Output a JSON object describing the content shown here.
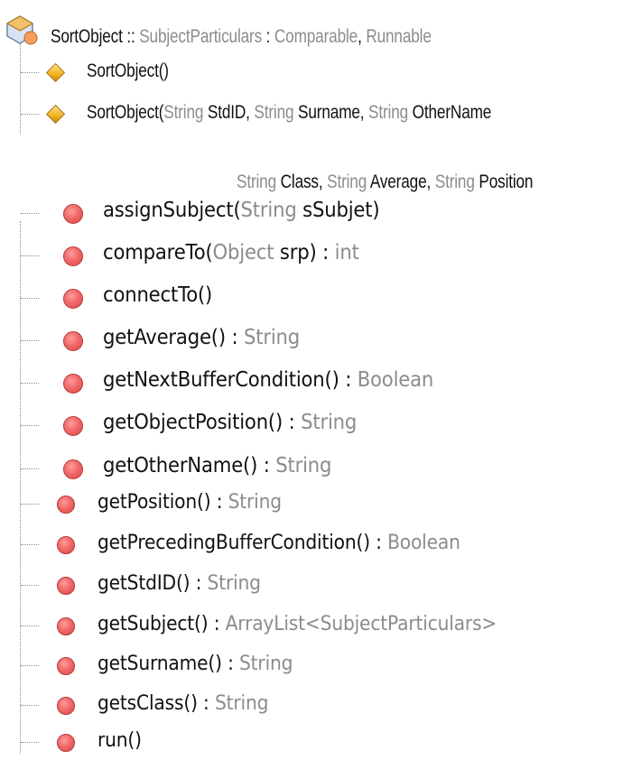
{
  "header": {
    "name": "SortObject",
    "sep": " :: ",
    "extends": "SubjectParticulars",
    "colon": " : ",
    "iface1": "Comparable",
    "comma": ", ",
    "iface2": "Runnable"
  },
  "constructors": [
    {
      "name": "SortObject()"
    },
    {
      "name": "SortObject(",
      "params": [
        {
          "type": "String",
          "name": "StdID"
        },
        {
          "type": "String",
          "name": "Surname"
        },
        {
          "type": "String",
          "name": "OtherName"
        }
      ],
      "continuation": [
        {
          "type": "String",
          "name": "Class"
        },
        {
          "type": "String",
          "name": "Average"
        },
        {
          "type": "String",
          "name": "Position"
        }
      ]
    }
  ],
  "methods": [
    {
      "sig": "assignSubject(",
      "ptype": "String",
      "pname": "sSubjet",
      "close": ")",
      "ret_sep": "",
      "ret": ""
    },
    {
      "sig": "compareTo(",
      "ptype": "Object",
      "pname": "srp",
      "close": ")",
      "ret_sep": " : ",
      "ret": "int"
    },
    {
      "sig": "connectTo()",
      "ptype": "",
      "pname": "",
      "close": "",
      "ret_sep": "",
      "ret": ""
    },
    {
      "sig": "getAverage()",
      "ptype": "",
      "pname": "",
      "close": "",
      "ret_sep": " : ",
      "ret": "String"
    },
    {
      "sig": "getNextBufferCondition()",
      "ptype": "",
      "pname": "",
      "close": "",
      "ret_sep": " : ",
      "ret": "Boolean"
    },
    {
      "sig": "getObjectPosition()",
      "ptype": "",
      "pname": "",
      "close": "",
      "ret_sep": " : ",
      "ret": "String"
    },
    {
      "sig": "getOtherName()",
      "ptype": "",
      "pname": "",
      "close": "",
      "ret_sep": " : ",
      "ret": "String"
    },
    {
      "sig": "getPosition()",
      "ptype": "",
      "pname": "",
      "close": "",
      "ret_sep": " : ",
      "ret": "String"
    },
    {
      "sig": "getPrecedingBufferCondition()",
      "ptype": "",
      "pname": "",
      "close": "",
      "ret_sep": " : ",
      "ret": "Boolean"
    },
    {
      "sig": "getStdID()",
      "ptype": "",
      "pname": "",
      "close": "",
      "ret_sep": " : ",
      "ret": "String"
    },
    {
      "sig": "getSubject()",
      "ptype": "",
      "pname": "",
      "close": "",
      "ret_sep": " : ",
      "ret": "ArrayList<SubjectParticulars>"
    },
    {
      "sig": "getSurname()",
      "ptype": "",
      "pname": "",
      "close": "",
      "ret_sep": " : ",
      "ret": "String"
    },
    {
      "sig": "getsClass()",
      "ptype": "",
      "pname": "",
      "close": "",
      "ret_sep": " : ",
      "ret": "String"
    },
    {
      "sig": "run()",
      "ptype": "",
      "pname": "",
      "close": "",
      "ret_sep": "",
      "ret": ""
    }
  ],
  "colors": {
    "method_icon": "#ef6464",
    "constructor_icon": "#f2b21d",
    "type_text": "#8c8c8c",
    "name_text": "#111111"
  },
  "icons": {
    "class": "class-icon",
    "constructor": "constructor-diamond-icon",
    "method": "method-circle-icon"
  }
}
